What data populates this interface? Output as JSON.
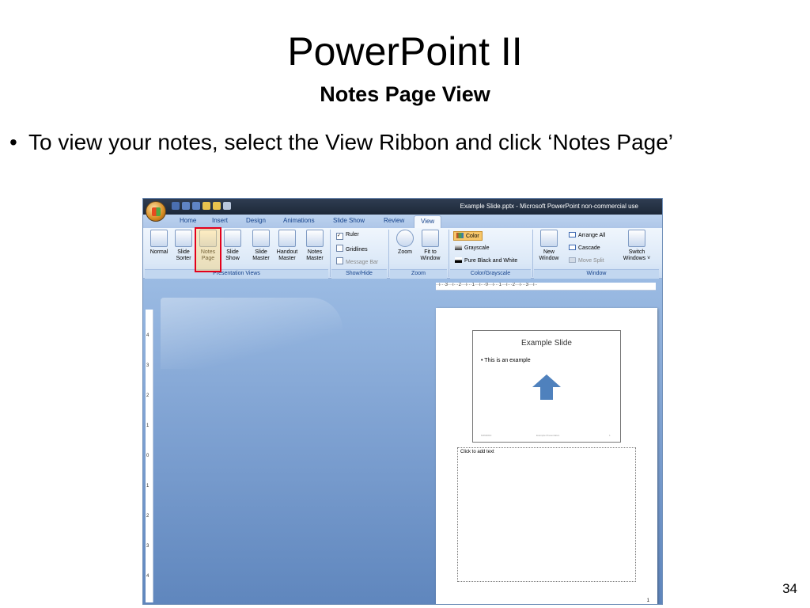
{
  "slide": {
    "title": "PowerPoint II",
    "subtitle": "Notes Page View",
    "bullet": "To view your notes, select the View Ribbon and click ‘Notes Page’",
    "number": "34"
  },
  "app": {
    "window_title": "Example Slide.pptx - Microsoft PowerPoint non-commercial use",
    "tabs": [
      "Home",
      "Insert",
      "Design",
      "Animations",
      "Slide Show",
      "Review",
      "View"
    ],
    "active_tab": "View",
    "groups": {
      "presentation_views": {
        "label": "Presentation Views",
        "buttons": [
          {
            "line1": "Normal",
            "line2": ""
          },
          {
            "line1": "Slide",
            "line2": "Sorter"
          },
          {
            "line1": "Notes",
            "line2": "Page"
          },
          {
            "line1": "Slide",
            "line2": "Show"
          },
          {
            "line1": "Slide",
            "line2": "Master"
          },
          {
            "line1": "Handout",
            "line2": "Master"
          },
          {
            "line1": "Notes",
            "line2": "Master"
          }
        ]
      },
      "show_hide": {
        "label": "Show/Hide",
        "ruler": "Ruler",
        "gridlines": "Gridlines",
        "message_bar": "Message Bar"
      },
      "zoom": {
        "label": "Zoom",
        "zoom_button": "Zoom",
        "fit_line1": "Fit to",
        "fit_line2": "Window"
      },
      "color": {
        "label": "Color/Grayscale",
        "color": "Color",
        "grayscale": "Grayscale",
        "pure_bw": "Pure Black and White"
      },
      "window": {
        "label": "Window",
        "new_line1": "New",
        "new_line2": "Window",
        "arrange_all": "Arrange All",
        "cascade": "Cascade",
        "move_split": "Move Split",
        "switch_line1": "Switch",
        "switch_line2": "Windows ˅"
      }
    },
    "ruler_top": "··ı···3···ı···2···ı···1···ı···0···ı···1···ı···2···ı···3···ı··",
    "ruler_left_numbers": [
      "4",
      "3",
      "2",
      "1",
      "0",
      "1",
      "2",
      "3",
      "4"
    ],
    "notes_page": {
      "slide_title": "Example Slide",
      "slide_bullet": "•  This is an  example",
      "footer_left": "6/29/2010",
      "footer_center": "Example Presentation",
      "footer_right": "1",
      "notes_placeholder": "Click to add text",
      "page_number": "1"
    }
  },
  "colors": {
    "highlight": "#e3001b",
    "arrow": "#4f81bd",
    "ribbon_text": "#15428b"
  }
}
